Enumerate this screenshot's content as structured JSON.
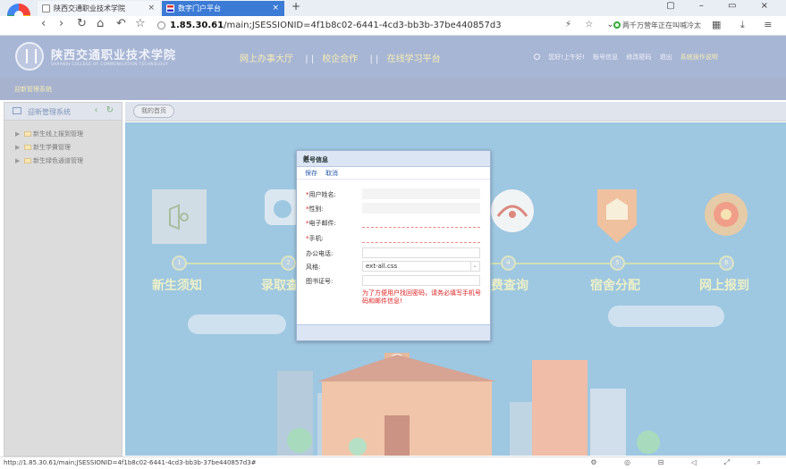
{
  "browser": {
    "tabs": [
      {
        "title": "陕西交通职业技术学院",
        "close": "×"
      },
      {
        "title": "数字门户平台",
        "close": "×"
      }
    ],
    "new_tab": "+",
    "nav": {
      "back": "‹",
      "forward": "›",
      "reload": "↻",
      "home": "⌂",
      "undo": "↶",
      "star": "☆"
    },
    "url_host": "1.85.30.61",
    "url_path": "/main;JSESSIONID=4f1b8c02-6441-4cd3-bb3b-37be440857d3",
    "addr_tools": "⚡ ☆ ⌄",
    "news": "两千万营年正在叫喊冷太",
    "right_tools": "▦ ⤓ ≡",
    "window_controls": "▢ – ▭ ×"
  },
  "header": {
    "school_cn": "陕西交通职业技术学院",
    "school_en": "SHAANXI COLLEGE OF COMMUNICATION TECHNOLOGY",
    "nav": [
      "网上办事大厅",
      "校企合作",
      "在线学习平台"
    ],
    "nav_sep": "| |",
    "user_greeting": "您好!上午好!",
    "user_links": [
      "账号信息",
      "修改密码",
      "退出"
    ],
    "help": "系统操作说明",
    "breadcrumb": "迎新管理系统"
  },
  "sidebar": {
    "title": "迎新管理系统",
    "controls": "‹ ↻",
    "items": [
      {
        "label": "新生线上报到管理",
        "arrow": "▶"
      },
      {
        "label": "新生学費管理",
        "arrow": "▶"
      },
      {
        "label": "新生绿色通道管理",
        "arrow": "▶"
      }
    ]
  },
  "home_tab": "我的首页",
  "steps": [
    {
      "num": "1",
      "label": "新生须知"
    },
    {
      "num": "2",
      "label": "录取查询"
    },
    {
      "num": "4",
      "label": "学费查询"
    },
    {
      "num": "5",
      "label": "宿舍分配"
    },
    {
      "num": "6",
      "label": "网上报到"
    }
  ],
  "modal": {
    "title": "账号信息",
    "close": "×",
    "toolbar": {
      "save": "保存",
      "cancel": "取消"
    },
    "fields": [
      {
        "label": "用户姓名:",
        "required": "*",
        "value": ""
      },
      {
        "label": "性别:",
        "required": "*",
        "value": ""
      },
      {
        "label": "电子邮件:",
        "required": "*",
        "value": ""
      },
      {
        "label": "手机:",
        "required": "*",
        "value": ""
      },
      {
        "label": "办公电话:",
        "required": "",
        "value": ""
      },
      {
        "label": "风格:",
        "required": "",
        "value": "ext-all.css"
      },
      {
        "label": "图书证号:",
        "required": "",
        "value": ""
      }
    ],
    "dropdown_arrow": "⌄",
    "warning": "为了方便用户找回密码，请务必填写手机号码和邮件信息!"
  },
  "status": {
    "url": "http://1.85.30.61/main;JSESSIONID=4f1b8c02-6441-4cd3-bb3b-37be440857d3#",
    "tools": "⚙ ◎ ⊟ ◁ ⤢ ⌕"
  },
  "colors": {
    "header_bg": "#7a8fbf",
    "content_bg": "#6aa9d1",
    "accent_yellow": "#f2e38a",
    "tab_active": "#3b7bd6"
  }
}
